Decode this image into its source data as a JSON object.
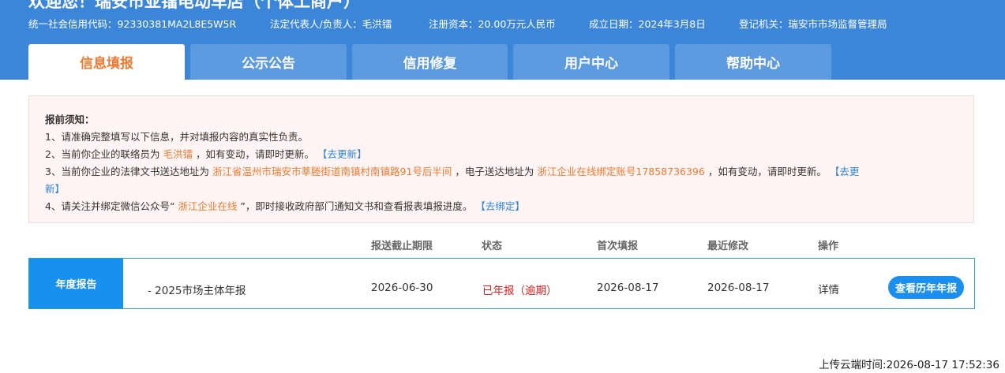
{
  "header": {
    "welcome": "欢迎您！瑞安市亚镭电动车店（个体工商户）",
    "credit_code": "统一社会信用代码：92330381MA2L8E5W5R",
    "legal_rep": "法定代表人/负责人：毛洪镭",
    "capital": "注册资本：20.00万元人民币",
    "established": "成立日期：2024年3月8日",
    "authority": "登记机关：瑞安市市场监督管理局"
  },
  "tabs": [
    {
      "label": "信息填报",
      "active": true
    },
    {
      "label": "公示公告",
      "active": false
    },
    {
      "label": "信用修复",
      "active": false
    },
    {
      "label": "用户中心",
      "active": false
    },
    {
      "label": "帮助中心",
      "active": false
    }
  ],
  "notice": {
    "title": "报前须知：",
    "item1": "1、请准确完整填写以下信息，并对填报内容的真实性负责。",
    "item2_prefix": "2、当前你企业的联络员为",
    "item2_name": "毛洪镭",
    "item2_suffix": "，如有变动，请即时更新。",
    "item2_link": "【去更新】",
    "item3_prefix": "3、当前你企业的法律文书送达地址为",
    "item3_address": "浙江省温州市瑞安市莘塍街道南镇村南镇路91号后半间",
    "item3_middle": "，电子送达地址为",
    "item3_account": "浙江企业在线绑定账号17858736396",
    "item3_suffix": "，如有变动，请即时更新。",
    "item3_link_a": "【去更",
    "item3_link_b": "新】",
    "item4_prefix": "4、请关注并绑定微信公众号“",
    "item4_name": "浙江企业在线",
    "item4_suffix": "”，即时接收政府部门通知文书和查看报表填报进度。",
    "item4_link": "【去绑定】"
  },
  "table": {
    "headers": {
      "deadline": "报送截止期限",
      "status": "状态",
      "first": "首次填报",
      "modified": "最近修改",
      "action": "操作"
    },
    "row": {
      "label": "年度报告",
      "name": "- 2025市场主体年报",
      "deadline": "2026-06-30",
      "status": "已年报（逾期）",
      "first": "2026-08-17",
      "modified": "2026-08-17",
      "detail": "详情",
      "history": "查看历年年报"
    }
  },
  "footer": {
    "upload_time": "上传云端时间:2026-08-17 17:52:36"
  },
  "colors": {
    "header_blue": "#3b86d8",
    "active_tab_text": "#f07a31",
    "status_red": "#e02020",
    "link_blue": "#2f86d6"
  }
}
